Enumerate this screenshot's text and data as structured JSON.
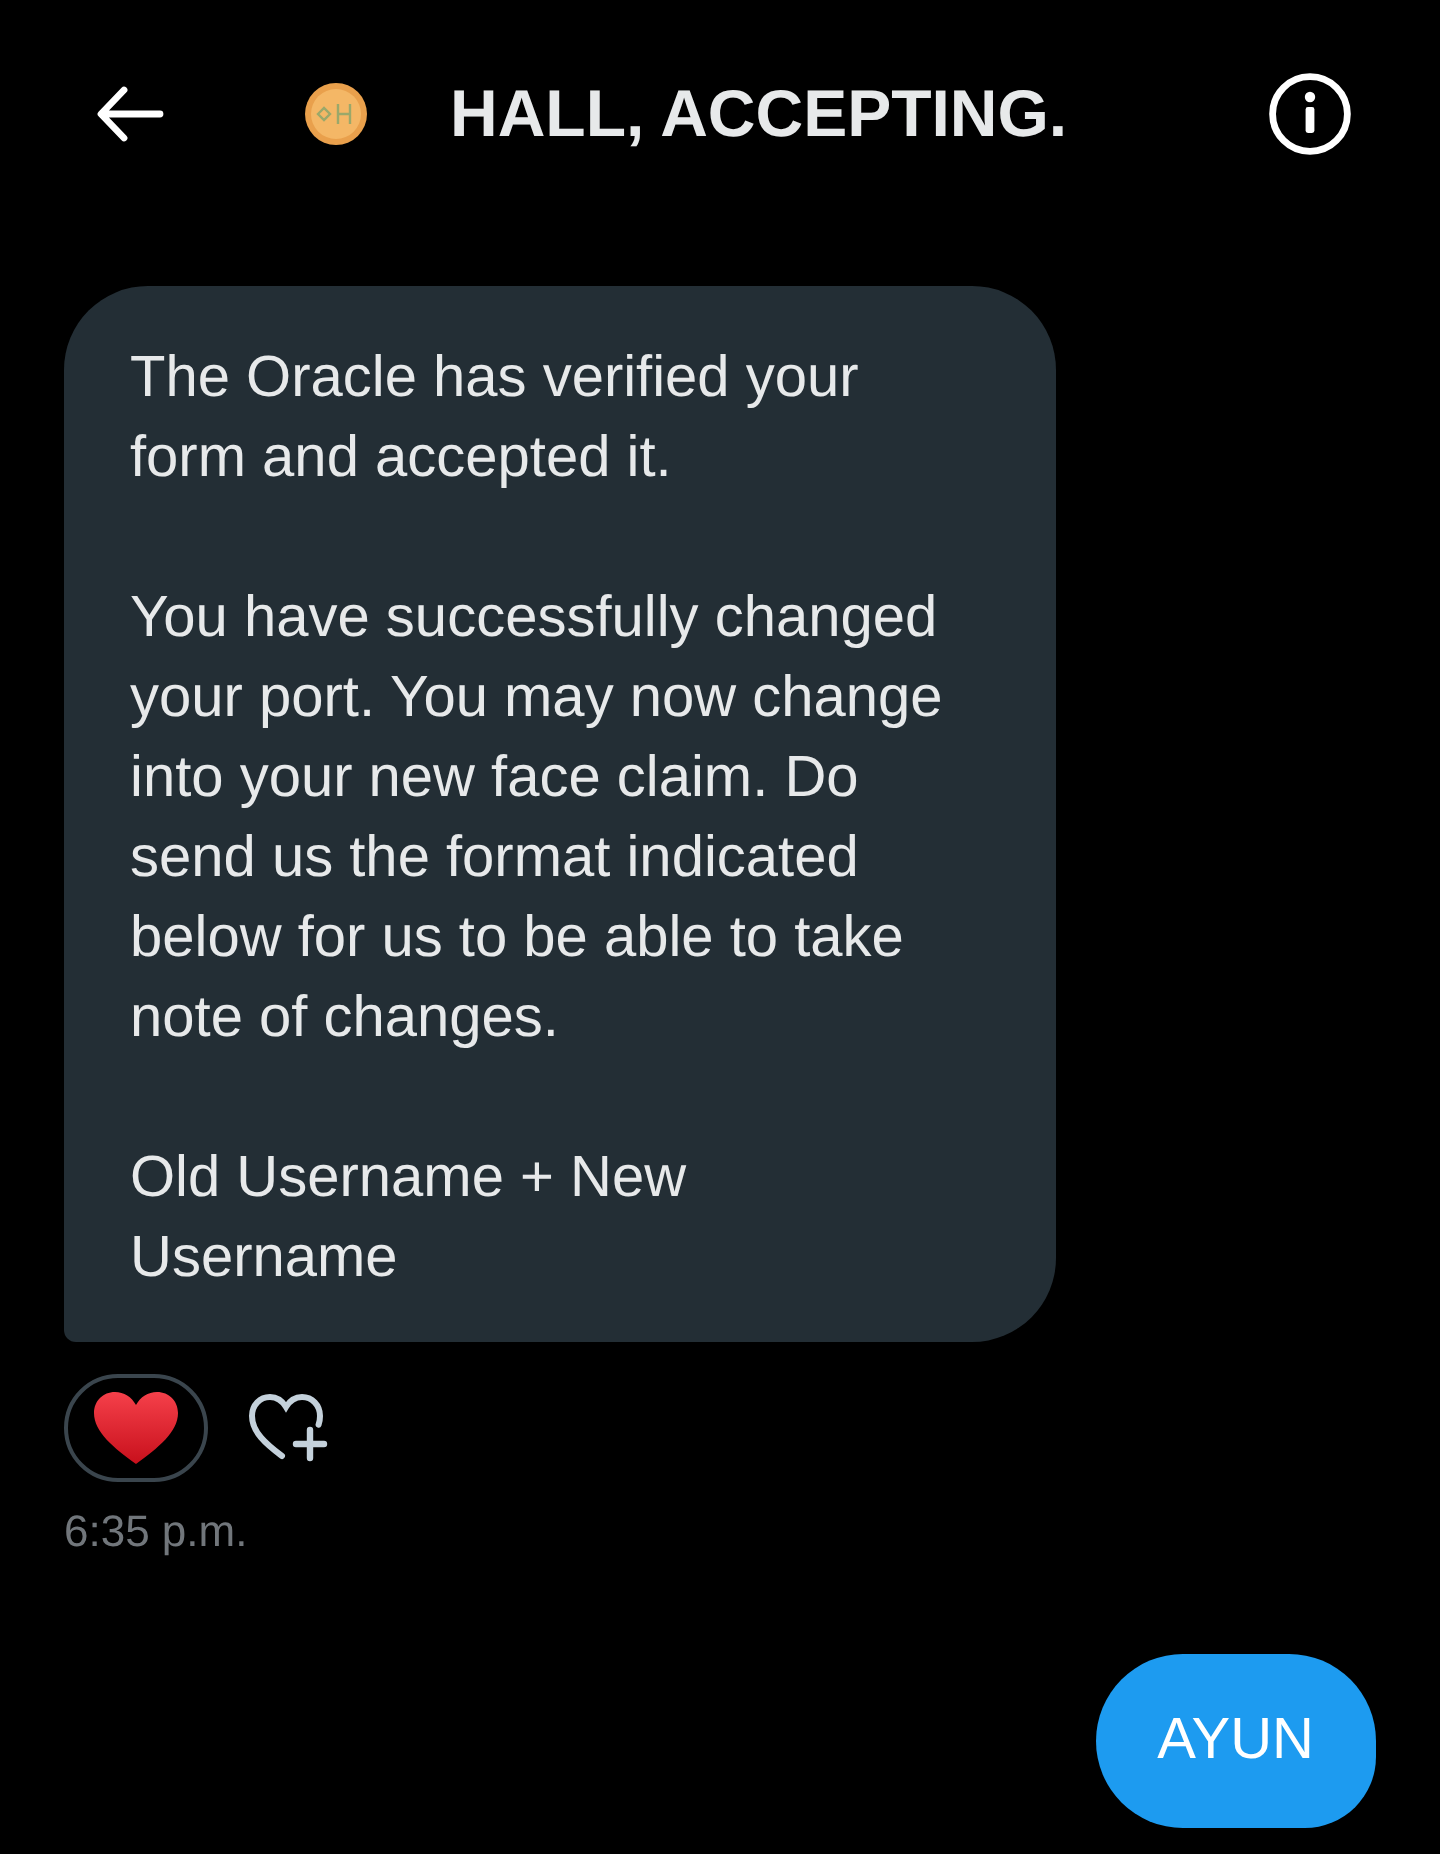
{
  "header": {
    "title": "HALL, ACCEPTING."
  },
  "messages": [
    {
      "kind": "received",
      "paragraphs": [
        "The Oracle has verified your form and accepted it.",
        "You have successfully changed your port. You may now change into your new face claim. Do send us the format indicated below for us to be able to take note of changes.",
        "Old Username + New Username"
      ],
      "time": "6:35 p.m."
    },
    {
      "kind": "sent",
      "text": "AYUN"
    }
  ]
}
